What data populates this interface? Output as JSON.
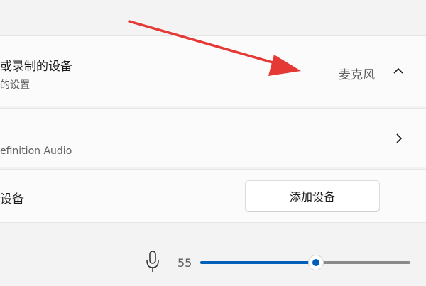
{
  "input_section": {
    "title": "或录制的设备",
    "subtitle": "的设置",
    "selected_value": "麦克风",
    "chevron_icon": "chevron-up-icon"
  },
  "device": {
    "name_fragment": "efinition Audio",
    "chevron_icon": "chevron-right-icon"
  },
  "add_device": {
    "label": "设备",
    "button_label": "添加设备"
  },
  "volume": {
    "icon": "microphone-icon",
    "value": "55",
    "level": 0.55,
    "accent_color": "#005fb8"
  },
  "annotation": {
    "arrow_color": "#e53935"
  }
}
